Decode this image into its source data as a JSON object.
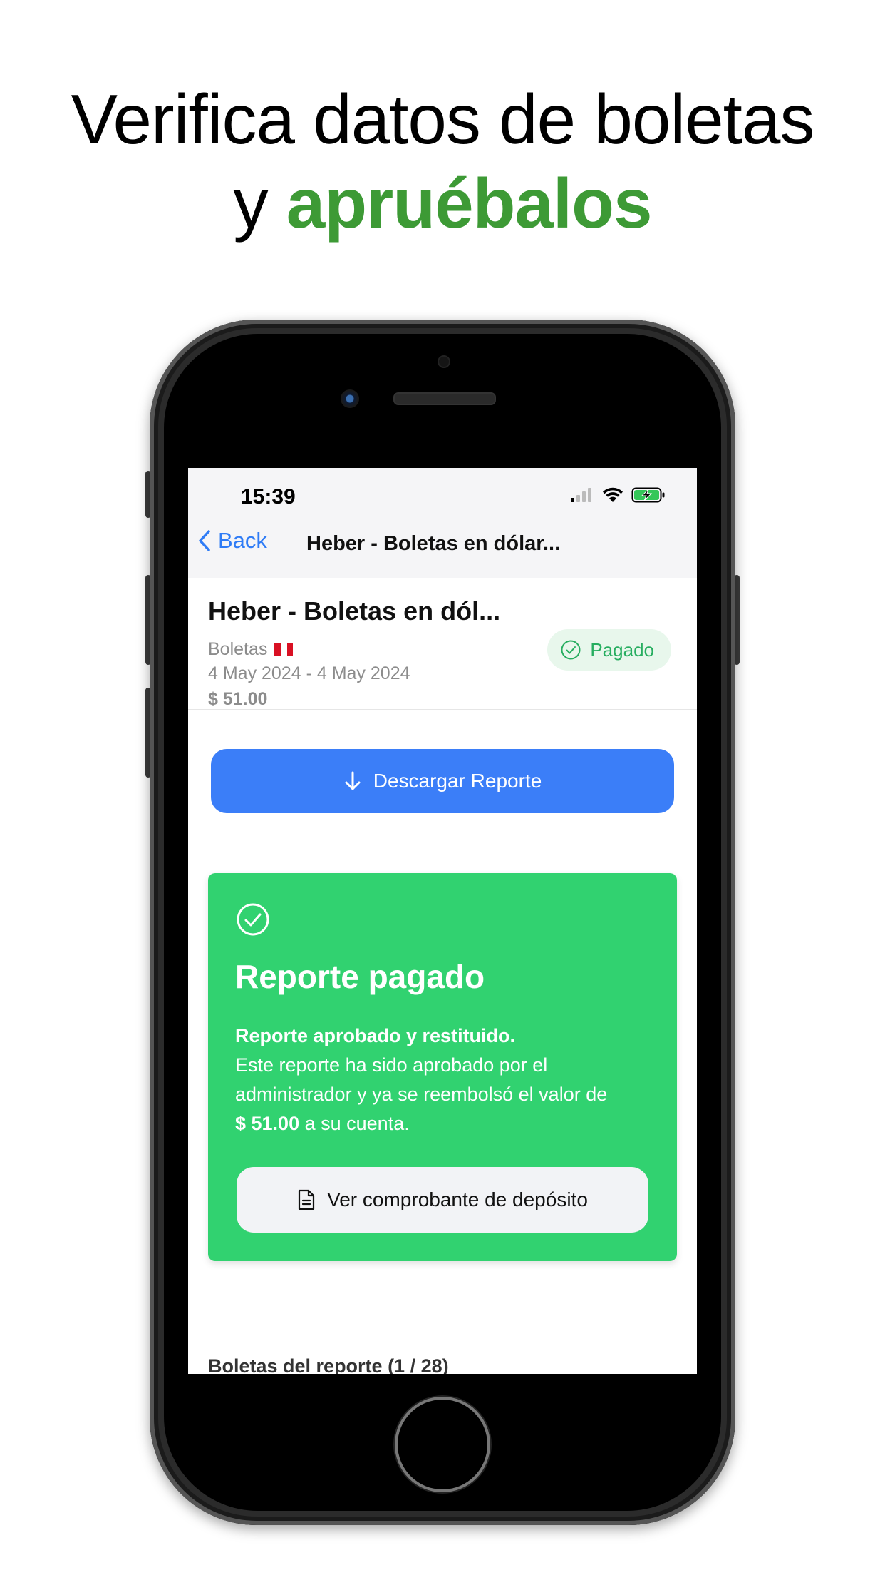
{
  "headline": {
    "line1": "Verifica datos de boletas",
    "line2_prefix": "y",
    "line2_accent": "apruébalos"
  },
  "colors": {
    "accent_green": "#3d9a35",
    "primary_blue": "#3b7ef8",
    "success_green": "#31d270",
    "badge_bg": "#e8f7ec",
    "badge_text": "#27ae60"
  },
  "status_bar": {
    "time": "15:39",
    "icons": [
      "cellular-signal-icon",
      "wifi-icon",
      "battery-charging-icon"
    ]
  },
  "nav": {
    "back_label": "Back",
    "title": "Heber - Boletas en dólar..."
  },
  "report": {
    "title": "Heber - Boletas en dól...",
    "category": "Boletas",
    "flag": "peru-flag-icon",
    "dates": "4 May 2024 - 4 May 2024",
    "amount": "$ 51.00",
    "status": "Pagado"
  },
  "download_button": {
    "label": "Descargar Reporte",
    "icon": "arrow-down-icon"
  },
  "paid_card": {
    "title": "Reporte pagado",
    "subtitle": "Reporte aprobado y restituido.",
    "body_text": "Este reporte ha sido aprobado por el administrador y ya se reembolsó el valor de",
    "amount": "$ 51.00",
    "body_suffix": "a su cuenta.",
    "receipt_button": "Ver comprobante de depósito"
  },
  "section": {
    "label": "Boletas del reporte (1 / 28)"
  }
}
